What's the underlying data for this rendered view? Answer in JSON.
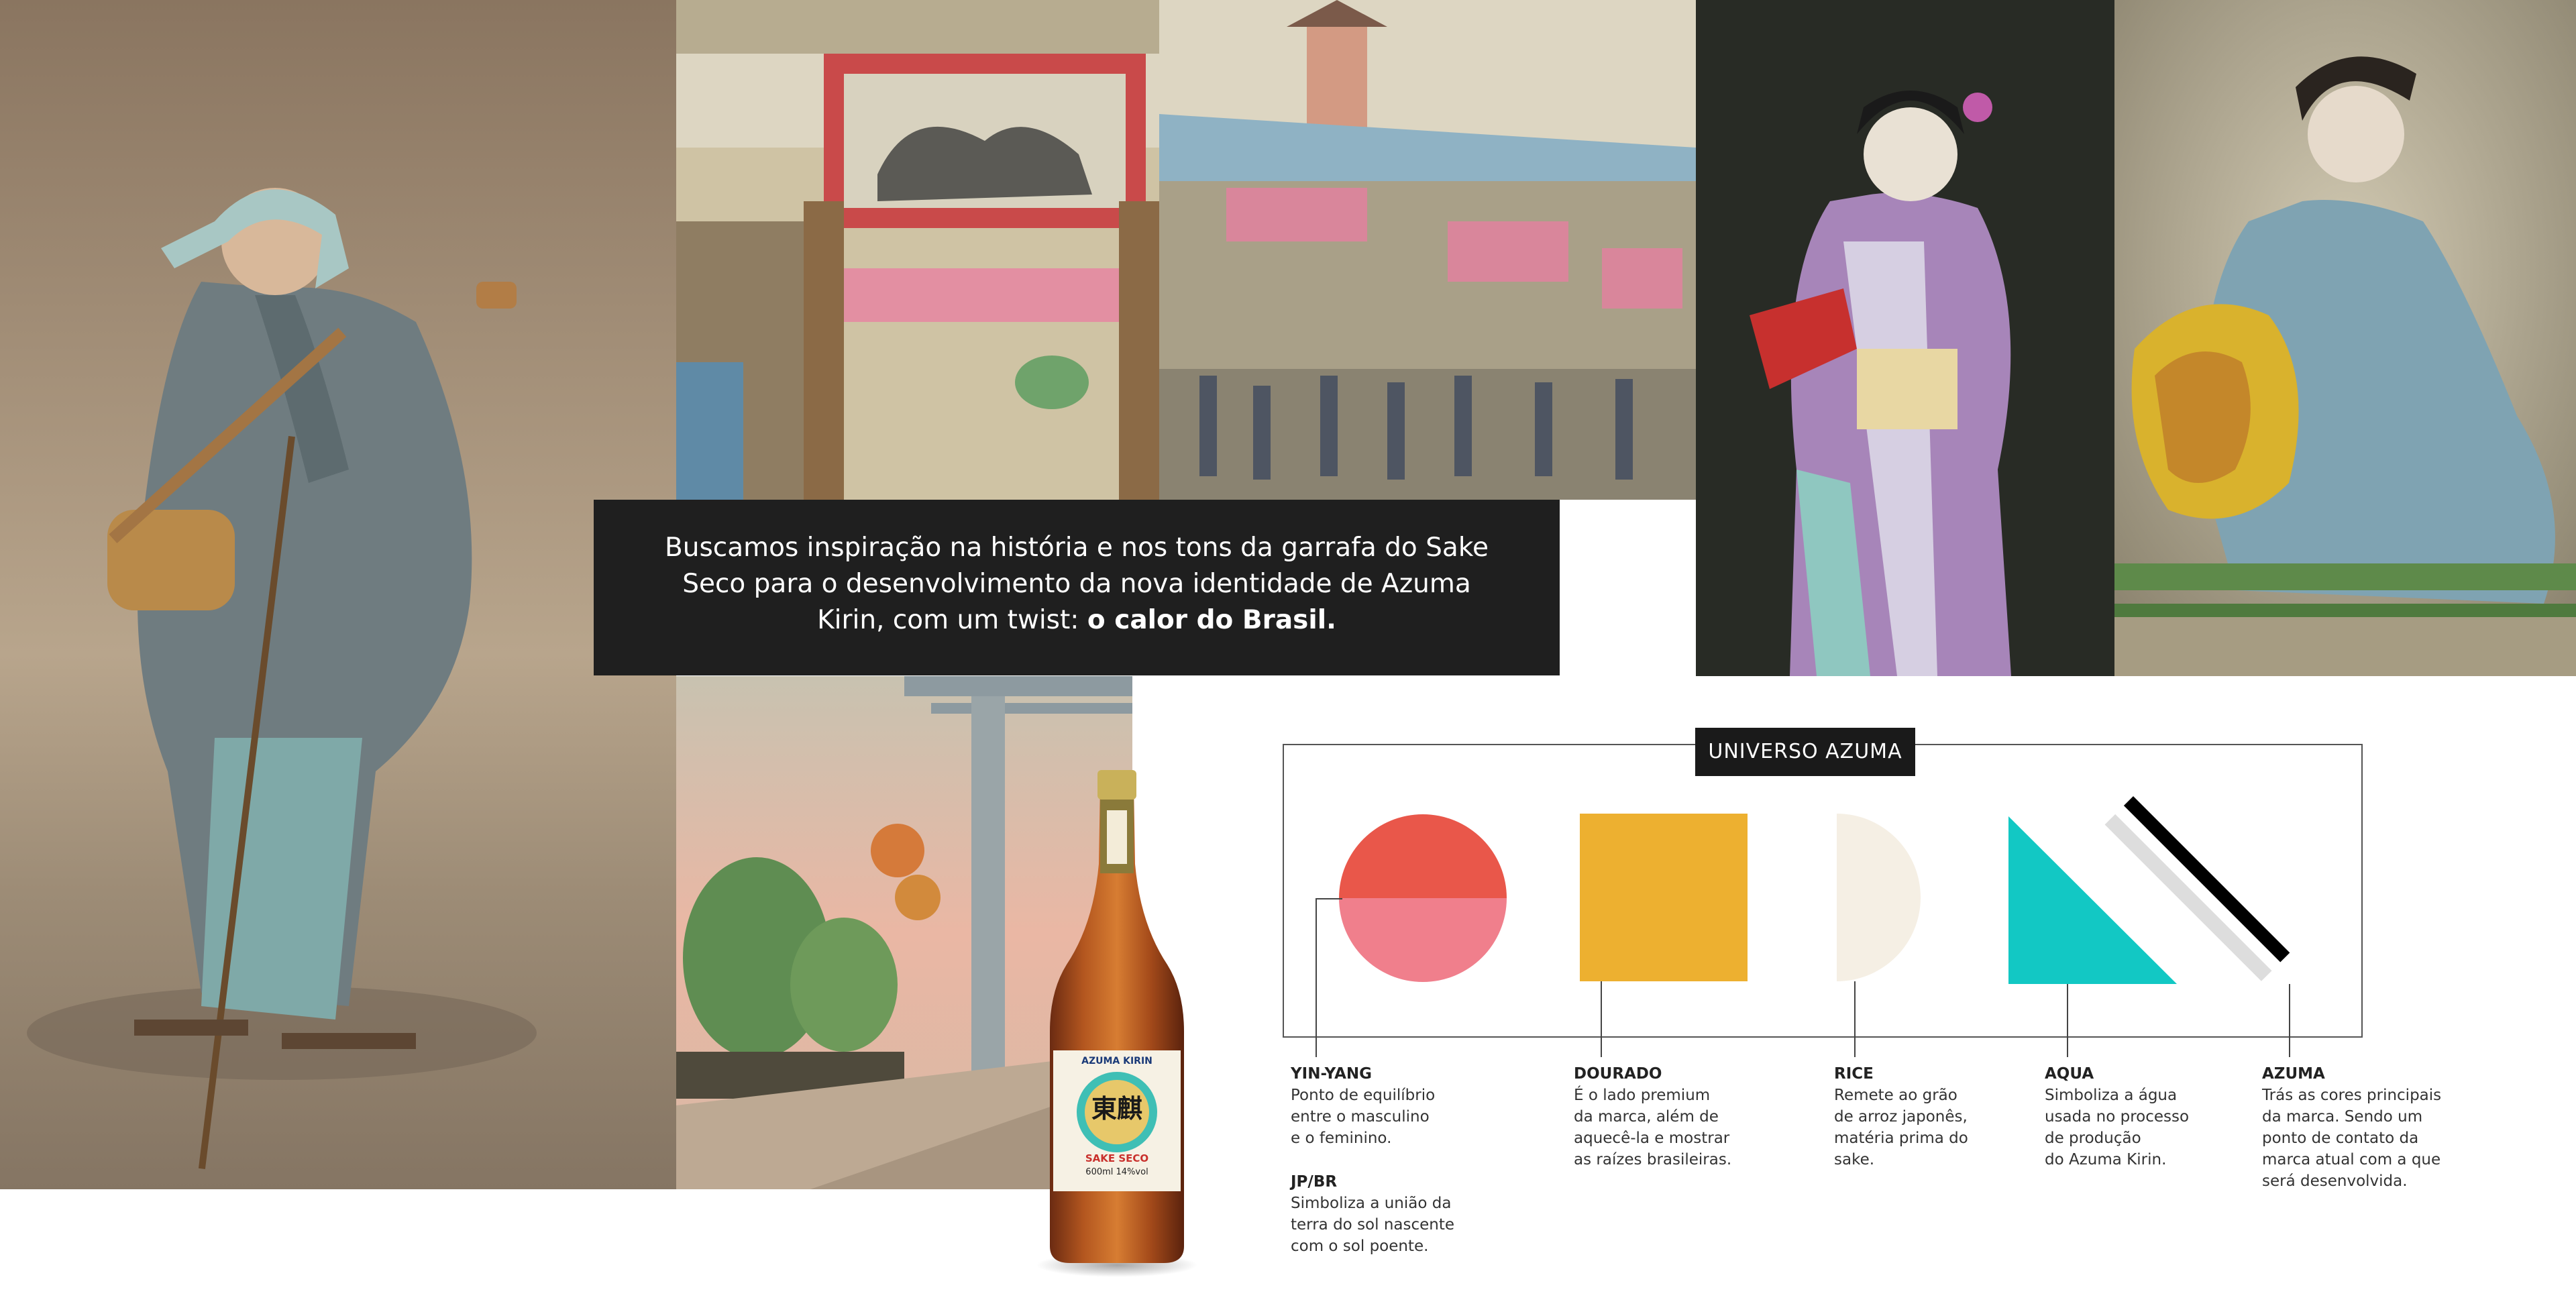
{
  "quote": {
    "lead": "Buscamos inspiração na história e nos tons da garrafa do Sake Seco para o desenvolvimento da nova identidade de Azuma Kirin, com um twist: ",
    "emphasis": "o calor do Brasil."
  },
  "panel": {
    "title": "UNIVERSO AZUMA"
  },
  "elements": [
    {
      "name": "YIN-YANG",
      "desc": [
        "Ponto de equilíbrio",
        "entre o masculino",
        "e o feminino."
      ],
      "colors": [
        "#e9574a",
        "#f07f8c"
      ]
    },
    {
      "name": "DOURADO",
      "desc": [
        "É o lado premium",
        "da marca, além de",
        "aquecê-la e mostrar",
        "as raízes brasileiras."
      ],
      "colors": [
        "#edb030"
      ]
    },
    {
      "name": "RICE",
      "desc": [
        "Remete ao grão",
        "de arroz japonês,",
        "matéria prima do",
        "sake."
      ],
      "colors": [
        "#f5efe4"
      ]
    },
    {
      "name": "AQUA",
      "desc": [
        "Simboliza a água",
        "usada no processo",
        "de produção",
        "do Azuma Kirin."
      ],
      "colors": [
        "#12c8c4"
      ]
    },
    {
      "name": "AZUMA",
      "desc": [
        "Trás as cores principais",
        "da marca. Sendo um",
        "ponto de contato da",
        "marca atual com a que",
        "será desenvolvida."
      ],
      "colors": [
        "#000000",
        "#ffffff",
        "#dddddd"
      ]
    }
  ],
  "jpbr": {
    "name": "JP/BR",
    "desc": [
      "Simboliza a união da",
      "terra do sol nascente",
      "com o sol poente."
    ]
  },
  "bottle": {
    "neck_label": "AZUMA KIRIN",
    "brand": "AZUMA KIRIN",
    "kanji": "東麒",
    "kanji2": "麟",
    "product": "SAKE SECO",
    "volume": "600ml",
    "abv": "14%vol"
  }
}
